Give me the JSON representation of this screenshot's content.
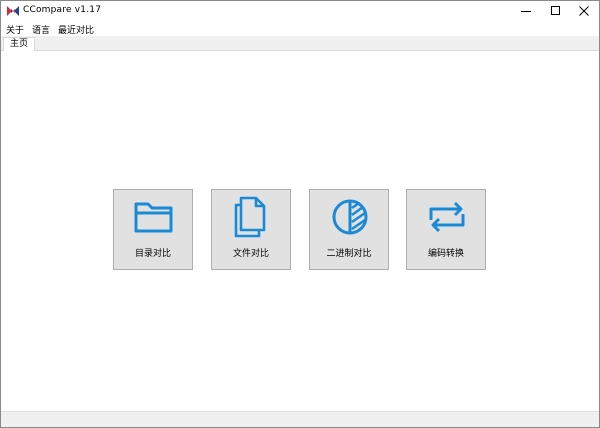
{
  "window": {
    "title": "CCompare   v1.17",
    "minimize_icon": "minimize-icon",
    "maximize_icon": "maximize-icon",
    "close_icon": "close-icon"
  },
  "menu": {
    "items": [
      "关于",
      "语言",
      "最近对比"
    ]
  },
  "tabs": [
    {
      "label": "主页",
      "active": true
    }
  ],
  "tiles": [
    {
      "label": "目录对比",
      "icon": "folder-icon"
    },
    {
      "label": "文件对比",
      "icon": "files-icon"
    },
    {
      "label": "二进制对比",
      "icon": "binary-compare-icon"
    },
    {
      "label": "编码转换",
      "icon": "encoding-convert-icon"
    }
  ],
  "colors": {
    "icon_blue": "#1a8ad6",
    "tile_bg": "#e1e1e1",
    "tile_border": "#adadad",
    "logo_red": "#e3262d",
    "logo_blue": "#1f3f9c"
  }
}
